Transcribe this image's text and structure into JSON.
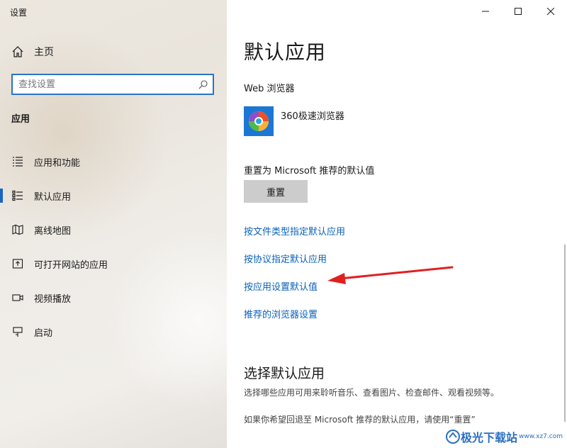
{
  "window": {
    "title": "设置"
  },
  "sidebar": {
    "home_label": "主页",
    "search_placeholder": "查找设置",
    "section_label": "应用",
    "items": [
      {
        "label": "应用和功能",
        "icon": "apps-features-icon"
      },
      {
        "label": "默认应用",
        "icon": "default-apps-icon",
        "active": true
      },
      {
        "label": "离线地图",
        "icon": "offline-maps-icon"
      },
      {
        "label": "可打开网站的应用",
        "icon": "apps-for-websites-icon"
      },
      {
        "label": "视频播放",
        "icon": "video-playback-icon"
      },
      {
        "label": "启动",
        "icon": "startup-icon"
      }
    ]
  },
  "main": {
    "title": "默认应用",
    "web_browser_label": "Web 浏览器",
    "browser_name": "360极速浏览器",
    "reset_label": "重置为 Microsoft 推荐的默认值",
    "reset_button": "重置",
    "links": [
      "按文件类型指定默认应用",
      "按协议指定默认应用",
      "按应用设置默认值",
      "推荐的浏览器设置"
    ],
    "section2_title": "选择默认应用",
    "section2_desc": "选择哪些应用可用来聆听音乐、查看图片、检查邮件、观看视频等。",
    "section2_note": "如果你希望回退至 Microsoft 推荐的默认应用，请使用“重置”"
  },
  "watermark": {
    "text": "极光下载站",
    "url": "www.xz7.com"
  },
  "colors": {
    "accent": "#0a62b8",
    "active_bar": "#1a66c2",
    "annotation_arrow": "#e02020"
  }
}
